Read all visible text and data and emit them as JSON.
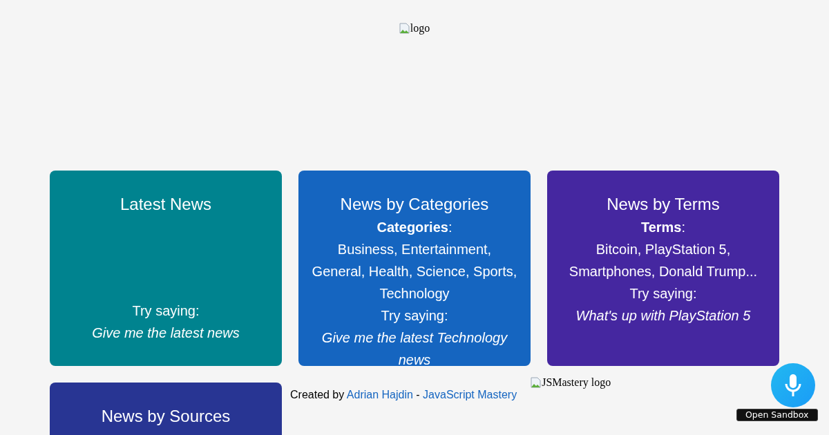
{
  "header": {
    "logo_alt": "logo"
  },
  "cards": [
    {
      "title": "Latest News",
      "color": "#00838f",
      "try_label": "Try saying:",
      "example": "Give me the latest news"
    },
    {
      "title": "News by Categories",
      "color": "#1565c0",
      "info_label": "**Categories**:",
      "info": "Business, Entertainment, General, Health, Science, Sports, Technology",
      "try_label": "Try saying:",
      "example": "Give me the latest Technology news"
    },
    {
      "title": "News by Terms",
      "color": "#4527a0",
      "info_label": "**Terms**:",
      "info": "Bitcoin, PlayStation 5, Smartphones, Donald Trump...",
      "try_label": "Try saying:",
      "example": "What's up with PlayStation 5"
    },
    {
      "title": "News by Sources",
      "color": "#283593"
    }
  ],
  "footer": {
    "prefix": "Created by",
    "author": "Adrian Hajdin",
    "separator": "-",
    "brand": "JavaScript Mastery",
    "logo_alt": "JSMastery logo"
  },
  "sandbox_button": {
    "label": "Open Sandbox"
  }
}
